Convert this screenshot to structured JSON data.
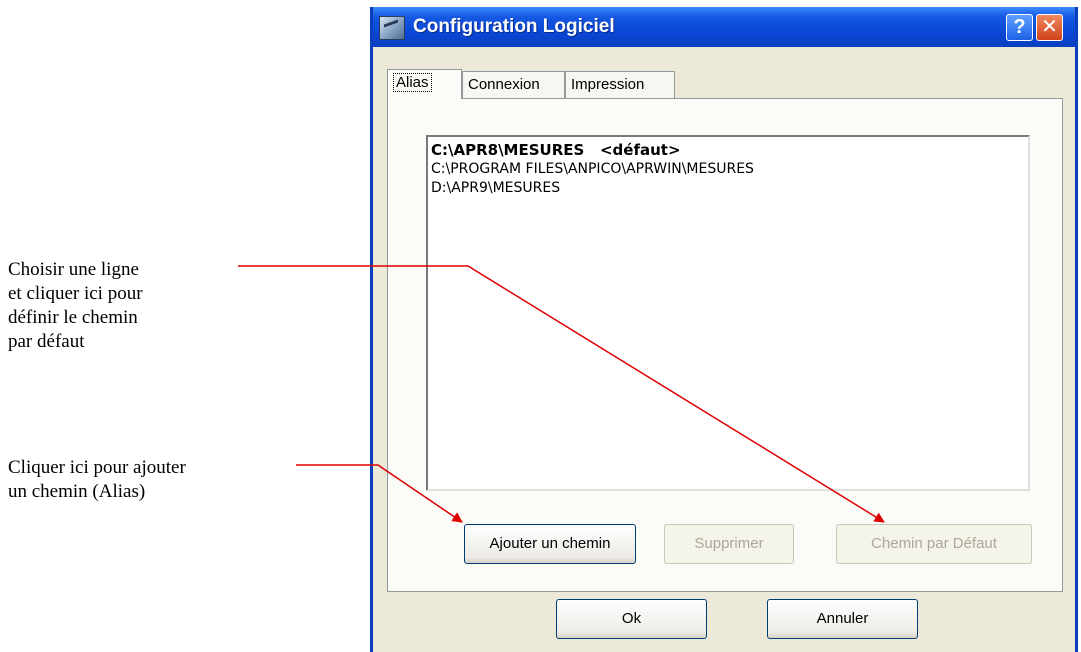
{
  "window": {
    "title": "Configuration Logiciel",
    "help_label": "?",
    "close_label": "✕"
  },
  "tabs": [
    {
      "label": "Alias",
      "active": true
    },
    {
      "label": "Connexion",
      "active": false
    },
    {
      "label": "Impression",
      "active": false
    }
  ],
  "alias_list": [
    {
      "text": "C:\\APR8\\MESURES   <défaut>",
      "default": true
    },
    {
      "text": "C:\\PROGRAM FILES\\ANPICO\\APRWIN\\MESURES",
      "default": false
    },
    {
      "text": "D:\\APR9\\MESURES",
      "default": false
    }
  ],
  "buttons": {
    "add_path": "Ajouter un chemin",
    "delete": "Supprimer",
    "default_path": "Chemin par Défaut",
    "ok": "Ok",
    "cancel": "Annuler"
  },
  "annotations": {
    "default_path_note": "Choisir une ligne\net cliquer ici pour\ndéfinir le chemin\npar défaut",
    "add_path_note": "Cliquer ici pour ajouter\nun chemin (Alias)"
  },
  "colors": {
    "titlebar": "#0a48d8",
    "arrow": "#e00000",
    "dialog_bg": "#ece9d8"
  }
}
